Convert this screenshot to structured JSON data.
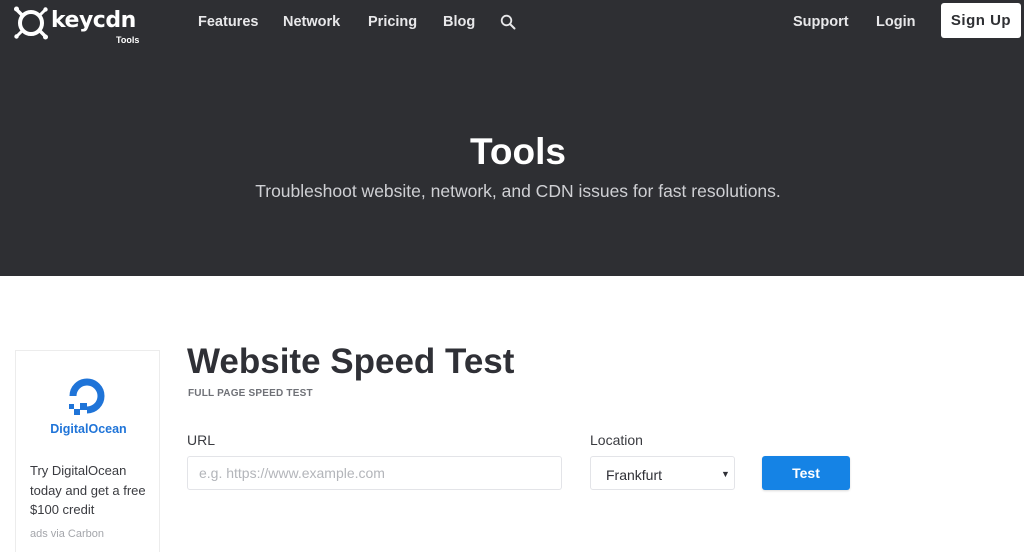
{
  "brand": {
    "name": "keycdn",
    "sub": "Tools"
  },
  "nav": {
    "items": [
      {
        "label": "Features"
      },
      {
        "label": "Network"
      },
      {
        "label": "Pricing"
      },
      {
        "label": "Blog"
      }
    ],
    "search_icon": "search-icon",
    "support": "Support",
    "login": "Login",
    "signup": "Sign Up"
  },
  "hero": {
    "title": "Tools",
    "subtitle": "Troubleshoot website, network, and CDN issues for fast resolutions."
  },
  "ad": {
    "brand": "DigitalOcean",
    "text": "Try DigitalOcean today and get a free $100 credit",
    "via": "ads via Carbon"
  },
  "tool": {
    "title": "Website Speed Test",
    "kicker": "FULL PAGE SPEED TEST",
    "url_label": "URL",
    "url_value": "",
    "url_placeholder": "e.g. https://www.example.com",
    "location_label": "Location",
    "location_value": "Frankfurt",
    "button": "Test"
  },
  "colors": {
    "hero_bg": "#2e2f33",
    "accent": "#1583e5",
    "digitalocean": "#1f74d8"
  }
}
